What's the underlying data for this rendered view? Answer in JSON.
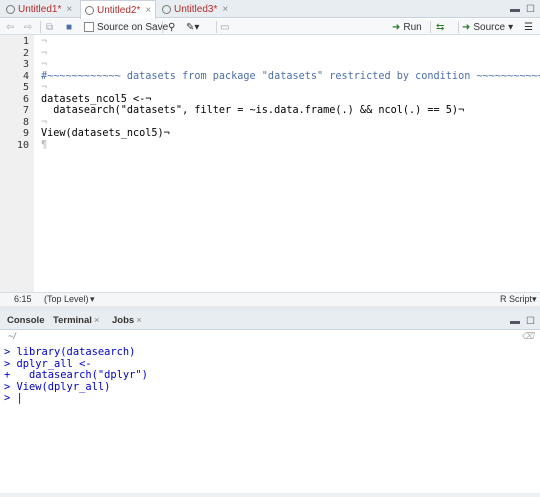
{
  "tabs": [
    {
      "label": "Untitled1*",
      "active": false
    },
    {
      "label": "Untitled2*",
      "active": true
    },
    {
      "label": "Untitled3*",
      "active": false
    }
  ],
  "toolbar": {
    "source_on_save": "Source on Save",
    "run": "Run",
    "source": "Source"
  },
  "editor": {
    "lines": [
      {
        "n": "1",
        "text": "¬"
      },
      {
        "n": "2",
        "text": "¬"
      },
      {
        "n": "3",
        "text": "¬"
      },
      {
        "n": "4",
        "text": "#~~~~~~~~~~~~ datasets from package \"datasets\" restricted by condition ~~~~~~~~~~~~¬"
      },
      {
        "n": "5",
        "text": "¬"
      },
      {
        "n": "6",
        "text": "datasets_ncol5 <-¬"
      },
      {
        "n": "7",
        "text": "  datasearch(\"datasets\", filter = ~is.data.frame(.) && ncol(.) == 5)¬"
      },
      {
        "n": "8",
        "text": "¬"
      },
      {
        "n": "9",
        "text": "View(datasets_ncol5)¬"
      },
      {
        "n": "10",
        "text": "¶"
      }
    ]
  },
  "status": {
    "position": "6:15",
    "scope": "(Top Level)",
    "filetype": "R Script"
  },
  "console_tabs": [
    {
      "label": "Console"
    },
    {
      "label": "Terminal"
    },
    {
      "label": "Jobs"
    }
  ],
  "console": {
    "cwd": "~/",
    "lines": [
      "> library(datasearch)",
      "> dplyr_all <-",
      "+   datasearch(\"dplyr\")",
      "> View(dplyr_all)",
      "> |"
    ]
  }
}
